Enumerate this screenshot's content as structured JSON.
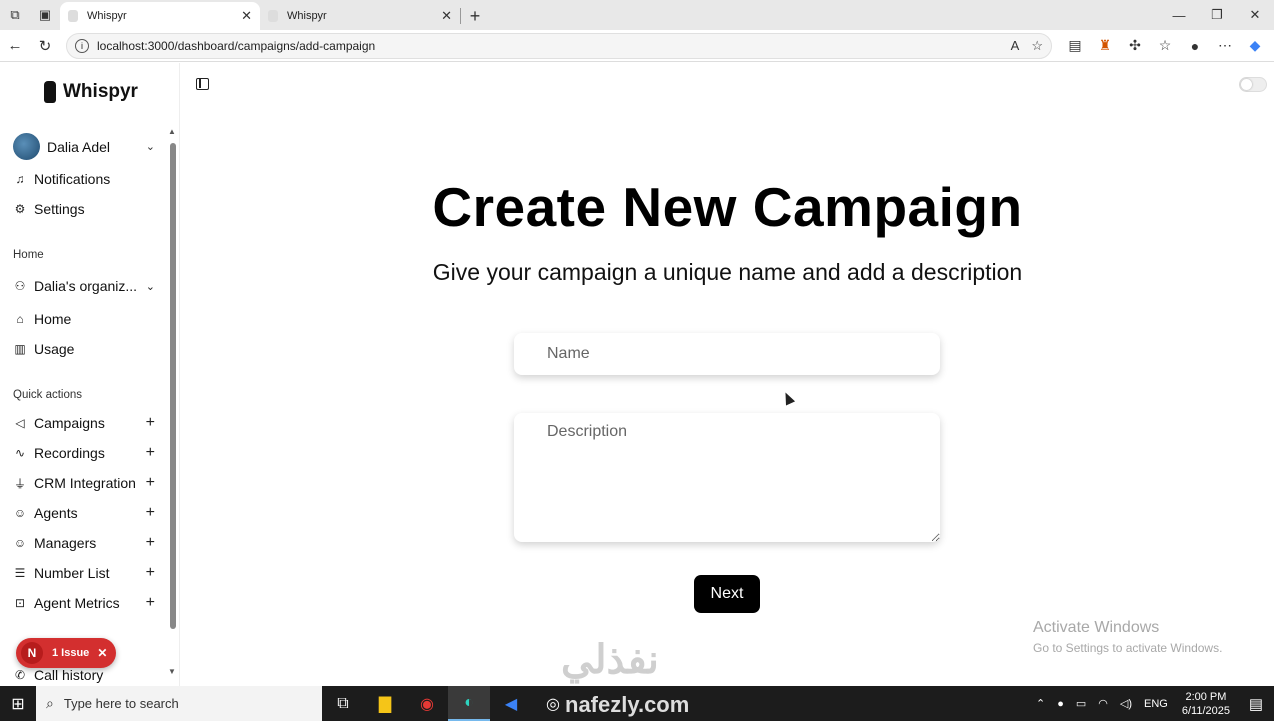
{
  "browser": {
    "tabs": [
      {
        "label": "Whispyr",
        "active": true
      },
      {
        "label": "Whispyr",
        "active": false
      }
    ],
    "url": "localhost:3000/dashboard/campaigns/add-campaign"
  },
  "sidebar": {
    "logo_text": "Whispyr",
    "user_name": "Dalia Adel",
    "top_items": [
      {
        "label": "Notifications",
        "icon": "bell-icon"
      },
      {
        "label": "Settings",
        "icon": "gear-icon"
      }
    ],
    "section_home": "Home",
    "org_label": "Dalia's organiz...",
    "home_items": [
      {
        "label": "Home",
        "icon": "home-icon"
      },
      {
        "label": "Usage",
        "icon": "chart-icon"
      }
    ],
    "section_quick": "Quick actions",
    "quick_items": [
      {
        "label": "Campaigns",
        "icon": "megaphone-icon"
      },
      {
        "label": "Recordings",
        "icon": "audio-wave-icon"
      },
      {
        "label": "CRM Integration",
        "icon": "plug-icon"
      },
      {
        "label": "Agents",
        "icon": "user-icon"
      },
      {
        "label": "Managers",
        "icon": "users-icon"
      },
      {
        "label": "Number List",
        "icon": "list-icon"
      },
      {
        "label": "Agent Metrics",
        "icon": "bot-icon"
      }
    ],
    "call_history": "Call history",
    "issue_badge": {
      "initial": "N",
      "label": "1 Issue"
    }
  },
  "main": {
    "heading": "Create New Campaign",
    "subheading": "Give your campaign a unique name and add a description",
    "name_placeholder": "Name",
    "description_placeholder": "Description",
    "next_label": "Next"
  },
  "overlay": {
    "activate_title": "Activate Windows",
    "activate_sub": "Go to Settings to activate Windows.",
    "watermark_ar": "نفذلي",
    "watermark_en": "nafezly.com"
  },
  "taskbar": {
    "search_placeholder": "Type here to search",
    "lang": "ENG",
    "time": "2:00 PM",
    "date": "6/11/2025"
  }
}
